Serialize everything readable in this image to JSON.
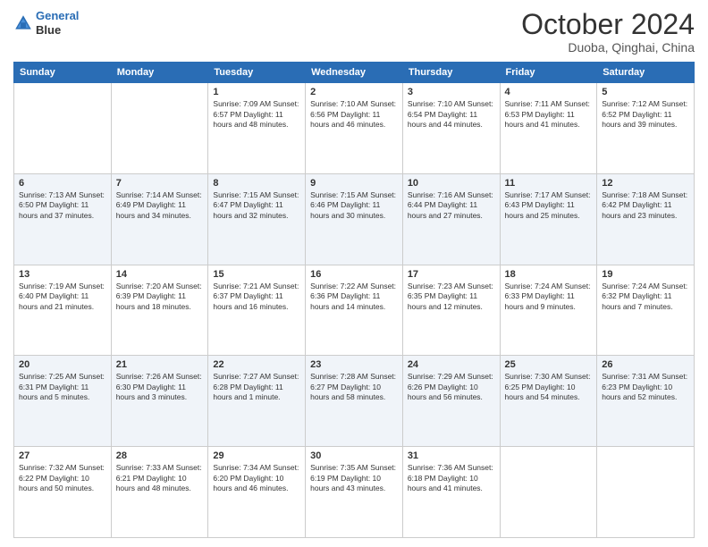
{
  "logo": {
    "line1": "General",
    "line2": "Blue"
  },
  "header": {
    "month": "October 2024",
    "location": "Duoba, Qinghai, China"
  },
  "weekdays": [
    "Sunday",
    "Monday",
    "Tuesday",
    "Wednesday",
    "Thursday",
    "Friday",
    "Saturday"
  ],
  "weeks": [
    [
      {
        "day": "",
        "info": ""
      },
      {
        "day": "",
        "info": ""
      },
      {
        "day": "1",
        "info": "Sunrise: 7:09 AM\nSunset: 6:57 PM\nDaylight: 11 hours and 48 minutes."
      },
      {
        "day": "2",
        "info": "Sunrise: 7:10 AM\nSunset: 6:56 PM\nDaylight: 11 hours and 46 minutes."
      },
      {
        "day": "3",
        "info": "Sunrise: 7:10 AM\nSunset: 6:54 PM\nDaylight: 11 hours and 44 minutes."
      },
      {
        "day": "4",
        "info": "Sunrise: 7:11 AM\nSunset: 6:53 PM\nDaylight: 11 hours and 41 minutes."
      },
      {
        "day": "5",
        "info": "Sunrise: 7:12 AM\nSunset: 6:52 PM\nDaylight: 11 hours and 39 minutes."
      }
    ],
    [
      {
        "day": "6",
        "info": "Sunrise: 7:13 AM\nSunset: 6:50 PM\nDaylight: 11 hours and 37 minutes."
      },
      {
        "day": "7",
        "info": "Sunrise: 7:14 AM\nSunset: 6:49 PM\nDaylight: 11 hours and 34 minutes."
      },
      {
        "day": "8",
        "info": "Sunrise: 7:15 AM\nSunset: 6:47 PM\nDaylight: 11 hours and 32 minutes."
      },
      {
        "day": "9",
        "info": "Sunrise: 7:15 AM\nSunset: 6:46 PM\nDaylight: 11 hours and 30 minutes."
      },
      {
        "day": "10",
        "info": "Sunrise: 7:16 AM\nSunset: 6:44 PM\nDaylight: 11 hours and 27 minutes."
      },
      {
        "day": "11",
        "info": "Sunrise: 7:17 AM\nSunset: 6:43 PM\nDaylight: 11 hours and 25 minutes."
      },
      {
        "day": "12",
        "info": "Sunrise: 7:18 AM\nSunset: 6:42 PM\nDaylight: 11 hours and 23 minutes."
      }
    ],
    [
      {
        "day": "13",
        "info": "Sunrise: 7:19 AM\nSunset: 6:40 PM\nDaylight: 11 hours and 21 minutes."
      },
      {
        "day": "14",
        "info": "Sunrise: 7:20 AM\nSunset: 6:39 PM\nDaylight: 11 hours and 18 minutes."
      },
      {
        "day": "15",
        "info": "Sunrise: 7:21 AM\nSunset: 6:37 PM\nDaylight: 11 hours and 16 minutes."
      },
      {
        "day": "16",
        "info": "Sunrise: 7:22 AM\nSunset: 6:36 PM\nDaylight: 11 hours and 14 minutes."
      },
      {
        "day": "17",
        "info": "Sunrise: 7:23 AM\nSunset: 6:35 PM\nDaylight: 11 hours and 12 minutes."
      },
      {
        "day": "18",
        "info": "Sunrise: 7:24 AM\nSunset: 6:33 PM\nDaylight: 11 hours and 9 minutes."
      },
      {
        "day": "19",
        "info": "Sunrise: 7:24 AM\nSunset: 6:32 PM\nDaylight: 11 hours and 7 minutes."
      }
    ],
    [
      {
        "day": "20",
        "info": "Sunrise: 7:25 AM\nSunset: 6:31 PM\nDaylight: 11 hours and 5 minutes."
      },
      {
        "day": "21",
        "info": "Sunrise: 7:26 AM\nSunset: 6:30 PM\nDaylight: 11 hours and 3 minutes."
      },
      {
        "day": "22",
        "info": "Sunrise: 7:27 AM\nSunset: 6:28 PM\nDaylight: 11 hours and 1 minute."
      },
      {
        "day": "23",
        "info": "Sunrise: 7:28 AM\nSunset: 6:27 PM\nDaylight: 10 hours and 58 minutes."
      },
      {
        "day": "24",
        "info": "Sunrise: 7:29 AM\nSunset: 6:26 PM\nDaylight: 10 hours and 56 minutes."
      },
      {
        "day": "25",
        "info": "Sunrise: 7:30 AM\nSunset: 6:25 PM\nDaylight: 10 hours and 54 minutes."
      },
      {
        "day": "26",
        "info": "Sunrise: 7:31 AM\nSunset: 6:23 PM\nDaylight: 10 hours and 52 minutes."
      }
    ],
    [
      {
        "day": "27",
        "info": "Sunrise: 7:32 AM\nSunset: 6:22 PM\nDaylight: 10 hours and 50 minutes."
      },
      {
        "day": "28",
        "info": "Sunrise: 7:33 AM\nSunset: 6:21 PM\nDaylight: 10 hours and 48 minutes."
      },
      {
        "day": "29",
        "info": "Sunrise: 7:34 AM\nSunset: 6:20 PM\nDaylight: 10 hours and 46 minutes."
      },
      {
        "day": "30",
        "info": "Sunrise: 7:35 AM\nSunset: 6:19 PM\nDaylight: 10 hours and 43 minutes."
      },
      {
        "day": "31",
        "info": "Sunrise: 7:36 AM\nSunset: 6:18 PM\nDaylight: 10 hours and 41 minutes."
      },
      {
        "day": "",
        "info": ""
      },
      {
        "day": "",
        "info": ""
      }
    ]
  ]
}
